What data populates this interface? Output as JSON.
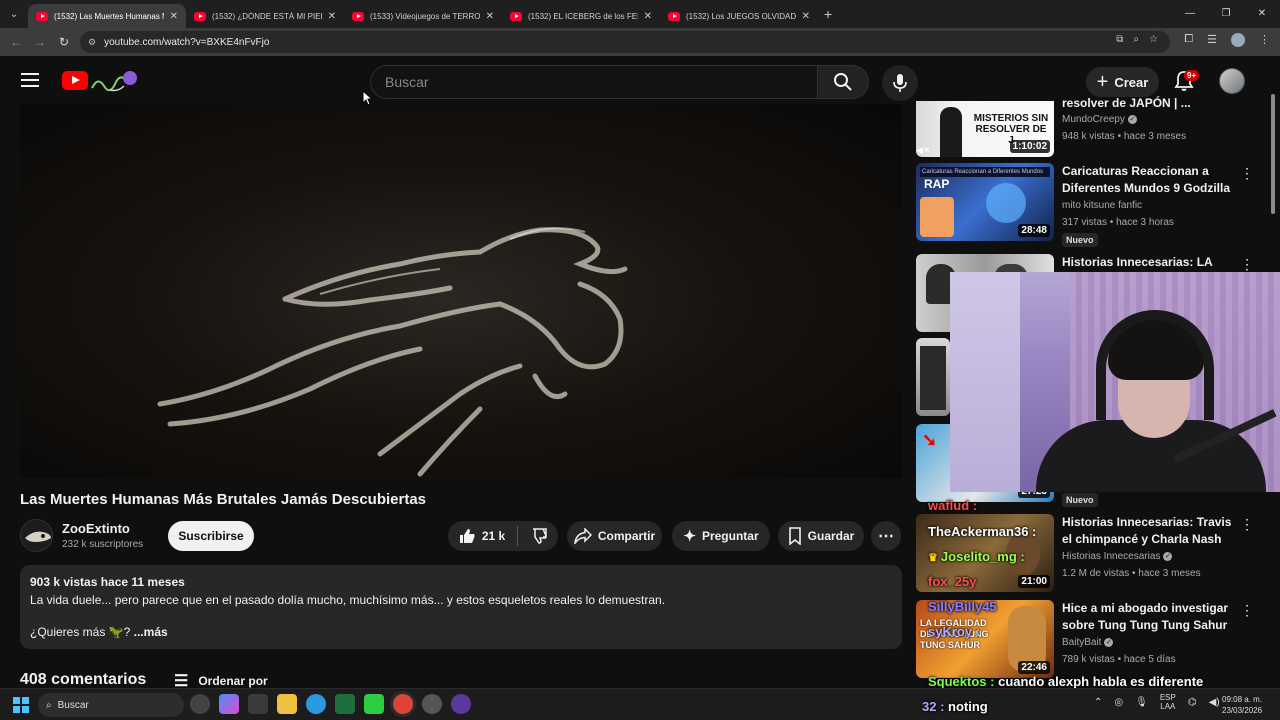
{
  "browser": {
    "tabs": [
      {
        "title": "(1532) Las Muertes Humanas Más",
        "active": true
      },
      {
        "title": "(1532) ¿DÓNDE ESTÁ MI PIEL? - ",
        "active": false
      },
      {
        "title": "(1533) Videojuegos de TERROR",
        "active": false
      },
      {
        "title": "(1532) EL ICEBERG de los FENÓ",
        "active": false
      },
      {
        "title": "(1532) Los JUEGOS OLVIDADOS",
        "active": false
      }
    ],
    "url": "youtube.com/watch?v=BXKE4nFvFjo"
  },
  "header": {
    "search_placeholder": "Buscar",
    "create_label": "Crear",
    "notification_badge": "9+"
  },
  "video": {
    "title": "Las Muertes Humanas Más Brutales Jamás Descubiertas",
    "channel": "ZooExtinto",
    "subscribers": "232 k suscriptores",
    "subscribe_label": "Suscribirse",
    "likes": "21 k",
    "share_label": "Compartir",
    "ask_label": "Preguntar",
    "save_label": "Guardar"
  },
  "description": {
    "meta": "903 k vistas  hace 11 meses",
    "text": "La vida duele... pero parece que en el pasado dolía mucho, muchísimo más... y estos esqueletos reales lo demuestran.",
    "prompt": "¿Quieres más 🦖? ",
    "more": "...más"
  },
  "comments": {
    "count": "408 comentarios",
    "sort_label": "Ordenar por"
  },
  "recommendations": [
    {
      "title": "resolver de JAPÓN | ...",
      "channel": "MundoCreepy",
      "verified": true,
      "stats": "948 k vistas • hace 3 meses",
      "duration": "1:10:02",
      "new": "",
      "thumb_text": "MISTERIOS SIN RESOLVER DE J"
    },
    {
      "title": "Caricaturas Reaccionan a Diferentes Mundos 9 Godzilla ...",
      "channel": "mito kitsune fanfic",
      "verified": false,
      "stats": "317 vistas • hace 3 horas",
      "duration": "28:48",
      "new": "Nuevo",
      "thumb_text": "RAP"
    },
    {
      "title": "Historias Innecesarias: LA",
      "channel": "",
      "verified": false,
      "stats": "",
      "duration": "",
      "new": "",
      "thumb_text": ""
    },
    {
      "title": "",
      "channel": "",
      "verified": false,
      "stats": "",
      "duration": "27:23",
      "new": "Nuevo",
      "thumb_text": ""
    },
    {
      "title": "Historias Innecesarias: Travis el chimpancé y Charla Nash",
      "channel": "Historias Innecesarias",
      "verified": true,
      "stats": "1.2 M de vistas • hace 3 meses",
      "duration": "21:00",
      "new": "",
      "thumb_text": ""
    },
    {
      "title": "Hice a mi abogado investigar sobre Tung Tung Tung Sahur",
      "channel": "BaityBait",
      "verified": true,
      "stats": "789 k vistas • hace 5 días",
      "duration": "22:46",
      "new": "",
      "thumb_text": "LA LEGALIDAD DE TUNG TUNG TUNG SAHUR"
    }
  ],
  "chat": [
    {
      "user": "waflud :",
      "msg": "",
      "color": "#ff4d4d"
    },
    {
      "user": "TheAckerman36 :",
      "msg": "",
      "color": "#ffffff"
    },
    {
      "user": "Joselito_mg :",
      "msg": "",
      "color": "#9aff4d"
    },
    {
      "user": "fox_25y",
      "msg": "",
      "color": "#ff4d4d"
    },
    {
      "user": "SillyBilly45",
      "msg": "",
      "color": "#8a7dff"
    },
    {
      "user": "syKroy :",
      "msg": "",
      "color": "#b9a7ff"
    },
    {
      "user": "Squektos :",
      "msg": "cuando alexph habla es diferente",
      "color": "#7dff4d"
    },
    {
      "user": "32 :",
      "msg": "noting",
      "color": "#b9a7ff"
    }
  ],
  "taskbar": {
    "search_label": "Buscar",
    "lang": "ESP",
    "lang2": "LAA",
    "time": "09:08 a. m.",
    "date": "23/03/2026"
  },
  "colors": {
    "background": "#0f0f0f",
    "surface": "#272727",
    "youtube_red": "#ff0000",
    "webcam_purple": "#9a86c2"
  }
}
